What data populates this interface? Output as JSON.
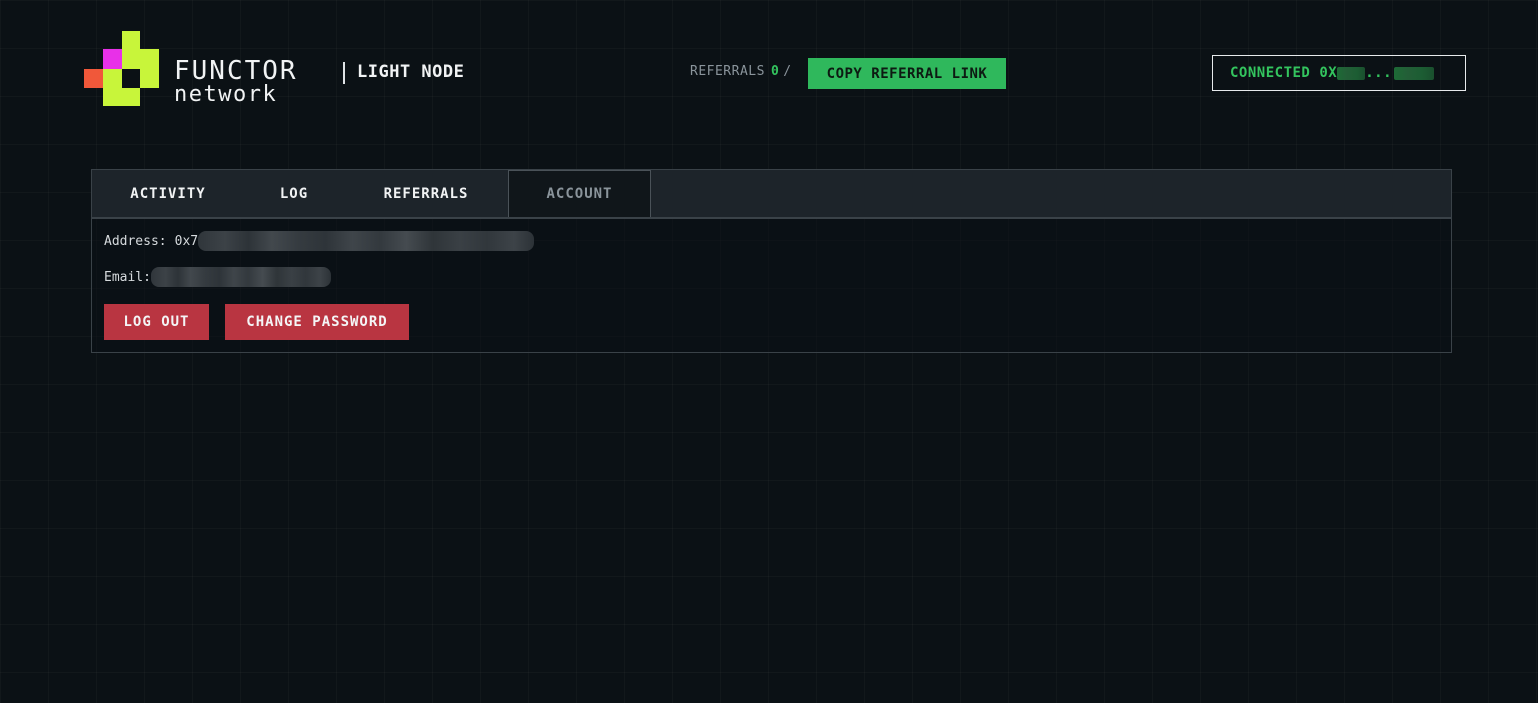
{
  "header": {
    "brand_name": "FUNCTOR",
    "brand_sub": "network",
    "node_type": "LIGHT NODE",
    "referrals_label": "REFERRALS",
    "referrals_count": "0",
    "referrals_separator": "/",
    "copy_referral_label": "COPY REFERRAL LINK",
    "connected_label": "CONNECTED",
    "connected_address_prefix": "0X",
    "connected_address_ellipsis": "..."
  },
  "tabs": [
    {
      "label": "ACTIVITY",
      "active": false
    },
    {
      "label": "LOG",
      "active": false
    },
    {
      "label": "REFERRALS",
      "active": false
    },
    {
      "label": "ACCOUNT",
      "active": true
    }
  ],
  "account": {
    "address_label": "Address:",
    "address_prefix": "0x7",
    "email_label": "Email:",
    "logout_label": "LOG OUT",
    "change_password_label": "CHANGE PASSWORD"
  },
  "colors": {
    "background": "#0b1115",
    "accent_green": "#2fb85c",
    "danger_red": "#b93541",
    "logo_lime": "#c8f53a",
    "logo_magenta": "#e830e8",
    "logo_orange": "#f0583a"
  }
}
